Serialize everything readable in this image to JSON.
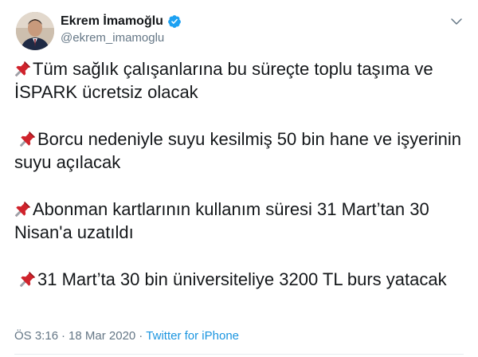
{
  "author": {
    "display_name": "Ekrem İmamoğlu",
    "handle": "@ekrem_imamoglu",
    "verified": true,
    "avatar_icon": "profile-photo"
  },
  "tweet": {
    "paragraphs": [
      {
        "icon": "pushpin-emoji",
        "text": "Tüm sağlık çalışanlarına bu süreçte toplu taşıma ve İSPARK ücretsiz olacak"
      },
      {
        "icon": "pushpin-emoji",
        "text": "Borcu nedeniyle suyu kesilmiş 50 bin hane ve işyerinin suyu açılacak"
      },
      {
        "icon": "pushpin-emoji",
        "text": "Abonman kartlarının kullanım süresi 31 Mart’tan 30 Nisan'a uzatıldı"
      },
      {
        "icon": "pushpin-emoji",
        "text": "31 Mart’ta 30 bin üniversiteliye 3200 TL burs yatacak"
      }
    ]
  },
  "meta": {
    "time": "ÖS 3:16",
    "separator": "·",
    "date": "18 Mar 2020",
    "source": "Twitter for iPhone"
  },
  "colors": {
    "text": "#14171a",
    "secondary": "#657786",
    "link": "#1b95e0",
    "verified": "#1da1f2",
    "pin_red": "#d0232c"
  }
}
